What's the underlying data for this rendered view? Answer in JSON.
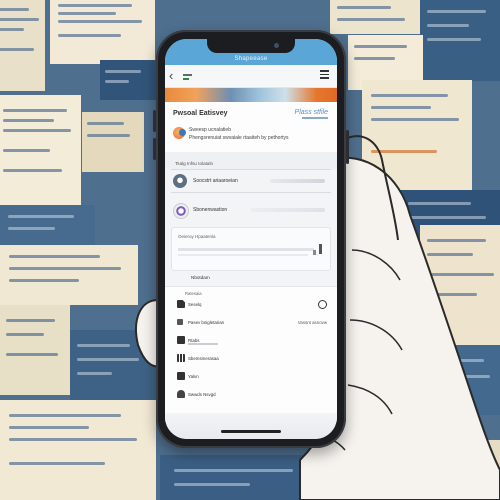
{
  "colors": {
    "background": "#4f6f8e",
    "phone_body": "#1c1d21",
    "status_bar": "#5aa6d6",
    "accent_orange": "#e26a2a",
    "skin": "#f6f2ee"
  },
  "phone": {
    "status_title": "Shapeease",
    "nav": {
      "back_icon": "chevron-left-icon",
      "menu_icon": "hamburger-menu-icon"
    },
    "profile": {
      "name": "Pwsoal Eatisvey",
      "right_text": "Plass stfile",
      "line1": "Sweesp ucnalatieb",
      "line2": "Phengsrenuiat swvaiale rtaaiteh by pethortys"
    },
    "section_label": "Tsalg Infsu tolataln",
    "rows": [
      {
        "label": "Soocstrt ariaaroeian",
        "icon": "user-circle-icon"
      },
      {
        "label": "Sbonenwastion",
        "icon": "sync-icon"
      }
    ],
    "card": {
      "label": "Oeieruy Hpaatenla"
    },
    "nav_label": "Nbotdam",
    "list": {
      "header": "Ratesaia",
      "items": [
        {
          "title": "Seselq",
          "end": "",
          "icon": "document-icon",
          "end_icon": "settings-circle-icon"
        },
        {
          "title": "Pasev bnigletarian",
          "end": "Vassnt asnovw",
          "icon": "tag-icon",
          "end_icon": ""
        },
        {
          "title": "Rtabs",
          "end": "",
          "icon": "folder-icon",
          "end_icon": ""
        },
        {
          "title": "Sbemsmerasaa",
          "end": "",
          "icon": "grid-icon",
          "end_icon": ""
        },
        {
          "title": "Yalvn",
          "end": "",
          "icon": "image-icon",
          "end_icon": ""
        },
        {
          "title": "Swwds Nsvgd",
          "end": "",
          "icon": "user-icon",
          "end_icon": ""
        }
      ]
    }
  }
}
